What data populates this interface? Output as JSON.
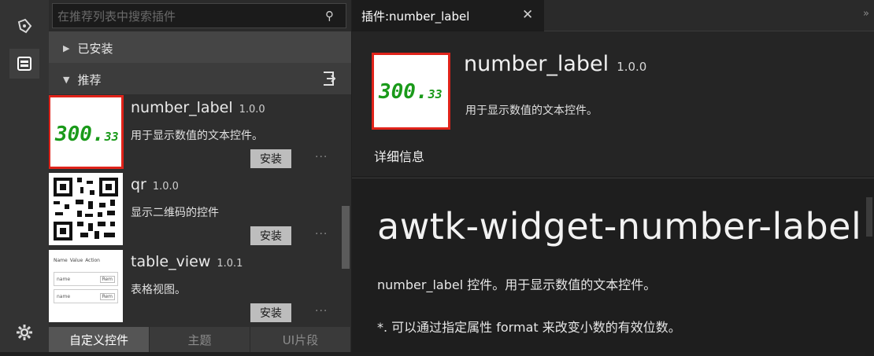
{
  "activity": {
    "icons": [
      "paint-icon",
      "plugins-icon",
      "settings-icon"
    ]
  },
  "search": {
    "placeholder": "在推荐列表中搜索插件"
  },
  "sections": {
    "installed": "已安装",
    "recommended": "推荐"
  },
  "list": [
    {
      "name": "number_label",
      "version": "1.0.0",
      "desc": "用于显示数值的文本控件。",
      "install": "安装",
      "thumb_text": "300.",
      "thumb_small": "33"
    },
    {
      "name": "qr",
      "version": "1.0.0",
      "desc": "显示二维码的控件",
      "install": "安装"
    },
    {
      "name": "table_view",
      "version": "1.0.1",
      "desc": "表格视图。",
      "install": "安装",
      "thumb_header": [
        "Name",
        "Value",
        "Action"
      ],
      "thumb_cells": [
        "name",
        "Rem",
        "name",
        "Rem"
      ]
    }
  ],
  "more_label": "···",
  "bottom_tabs": [
    "自定义控件",
    "主题",
    "UI片段"
  ],
  "editor": {
    "tab_title": "插件:number_label",
    "close": "✕",
    "chevron": "»",
    "plugin_name": "number_label",
    "plugin_version": "1.0.0",
    "plugin_desc": "用于显示数值的文本控件。",
    "detail_label": "详细信息",
    "doc_title": "awtk-widget-number-label",
    "doc_p1": "number_label 控件。用于显示数值的文本控件。",
    "doc_p2": "*. 可以通过指定属性 format 来改变小数的有效位数。"
  },
  "colors": {
    "accent_red": "#e0231a",
    "digit_green": "#1a9a1a"
  }
}
